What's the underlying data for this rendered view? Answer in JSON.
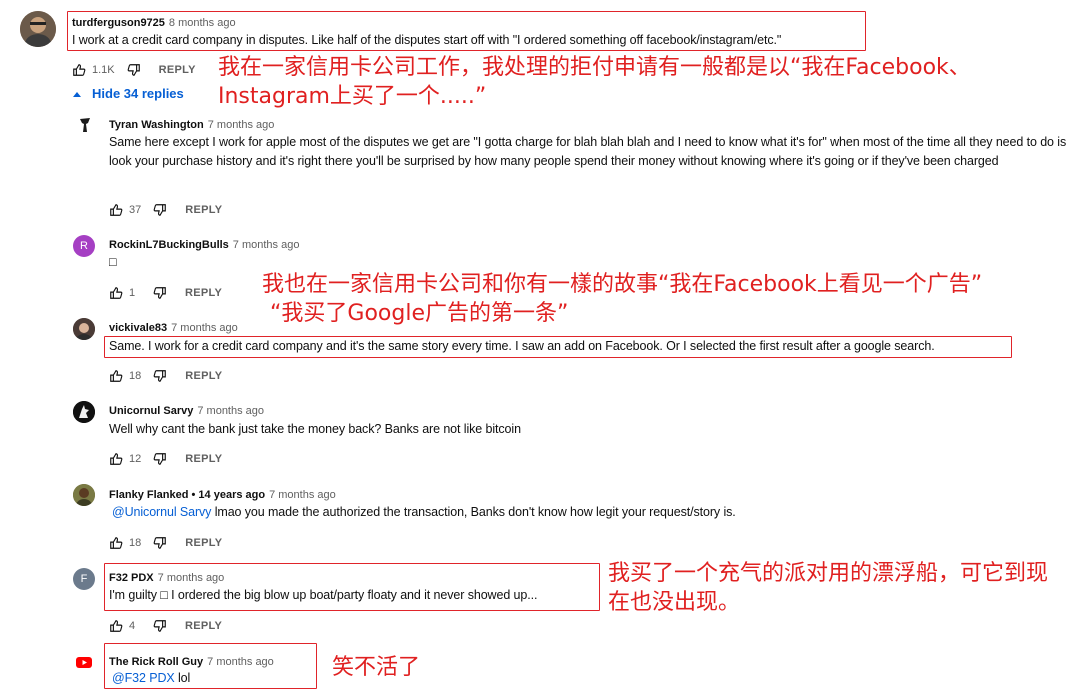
{
  "comments": [
    {
      "author": "turdferguson9725",
      "time": "8 months ago",
      "text": "I work at a credit card company in disputes. Like half of the disputes start off with \"I ordered something off facebook/instagram/etc.\"",
      "likes": "1.1K",
      "reply_label": "REPLY"
    },
    {
      "author": "Tyran Washington",
      "time": "7 months ago",
      "text": "Same here except I work for apple most of the disputes we get are \"I gotta charge for blah blah blah and I need to know what it's for\" when most of the time all they need to do is look your purchase history and it's right there you'll be surprised by how many people spend their money without knowing where it's going or if they've been charged",
      "likes": "37",
      "reply_label": "REPLY"
    },
    {
      "author": "RockinL7BuckingBulls",
      "time": "7 months ago",
      "text": "□",
      "likes": "1",
      "reply_label": "REPLY",
      "avatar_letter": "R"
    },
    {
      "author": "vickivale83",
      "time": "7 months ago",
      "text": "Same. I work for a credit card company and it's the same story every time. I saw an add on Facebook. Or I selected the first result after a google search.",
      "likes": "18",
      "reply_label": "REPLY"
    },
    {
      "author": "Unicornul Sarvy",
      "time": "7 months ago",
      "text": "Well why cant the bank just take the money back? Banks are not like bitcoin",
      "likes": "12",
      "reply_label": "REPLY"
    },
    {
      "author": "Flanky Flanked • 14 years ago",
      "time": "7 months ago",
      "mention": "@Unicornul Sarvy",
      "text": " lmao you made the authorized the transaction, Banks don't know how legit your request/story is.",
      "likes": "18",
      "reply_label": "REPLY"
    },
    {
      "author": "F32 PDX",
      "time": "7 months ago",
      "text": "I'm guilty □ I ordered the big blow up boat/party floaty and it never showed up...",
      "likes": "4",
      "reply_label": "REPLY",
      "avatar_letter": "F"
    },
    {
      "author": "The Rick Roll Guy",
      "time": "7 months ago",
      "mention": "@F32 PDX",
      "text": " lol"
    }
  ],
  "hide_replies_label": "Hide 34 replies",
  "annotations": {
    "a1_line1": "我在一家信用卡公司工作，我处理的拒付申请有一般都是以“我在Facebook、",
    "a1_line2": "Instagram上买了一个.....”",
    "a2_line1": "我也在一家信用卡公司和你有一樣的故事“我在Facebook上看见一个广告”",
    "a2_line2": "“我买了Google广告的第一条”",
    "a3_line1": "我买了一个充气的派对用的漂浮船，可它到现",
    "a3_line2": "在也没出现。",
    "a4": "笑不活了"
  },
  "colors": {
    "annotation_red": "#e02020",
    "link_blue": "#065fd4",
    "meta_gray": "#606060"
  }
}
